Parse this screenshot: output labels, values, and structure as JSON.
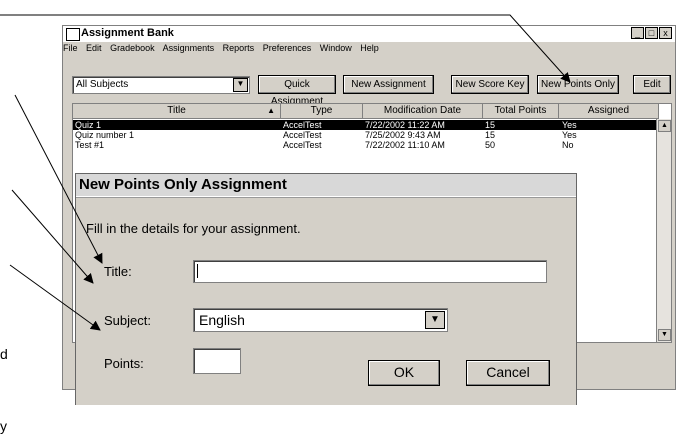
{
  "window": {
    "title": "Assignment Bank",
    "buttons": [
      "_",
      "□",
      "x"
    ]
  },
  "menu": [
    "File",
    "Edit",
    "Gradebook",
    "Assignments",
    "Reports",
    "Preferences",
    "Window",
    "Help"
  ],
  "toolbar": {
    "subject_filter": "All Subjects",
    "quick_assignment": "Quick Assignment",
    "new_assignment": "New Assignment",
    "new_score_key": "New Score Key",
    "new_points_only": "New Points Only",
    "edit": "Edit"
  },
  "table": {
    "headers": [
      "Title",
      "Type",
      "Modification Date",
      "Total Points",
      "Assigned"
    ],
    "rows": [
      {
        "title": "Quiz 1",
        "type": "AccelTest",
        "date": "7/22/2002 11:22 AM",
        "points": "15",
        "assigned": "Yes"
      },
      {
        "title": "Quiz number 1",
        "type": "AccelTest",
        "date": "7/25/2002 9:43 AM",
        "points": "15",
        "assigned": "Yes"
      },
      {
        "title": "Test #1",
        "type": "AccelTest",
        "date": "7/22/2002 11:10 AM",
        "points": "50",
        "assigned": "No"
      }
    ]
  },
  "dialog": {
    "title": "New Points Only Assignment",
    "instruction": "Fill in the details for your assignment.",
    "title_label": "Title:",
    "title_value": "",
    "subject_label": "Subject:",
    "subject_value": "English",
    "points_label": "Points:",
    "points_value": "",
    "ok": "OK",
    "cancel": "Cancel"
  },
  "page_fragments": {
    "left_d": "d",
    "left_y": "y"
  },
  "colors": {
    "window_bg": "#d4d0c8",
    "selection": "#000000"
  }
}
